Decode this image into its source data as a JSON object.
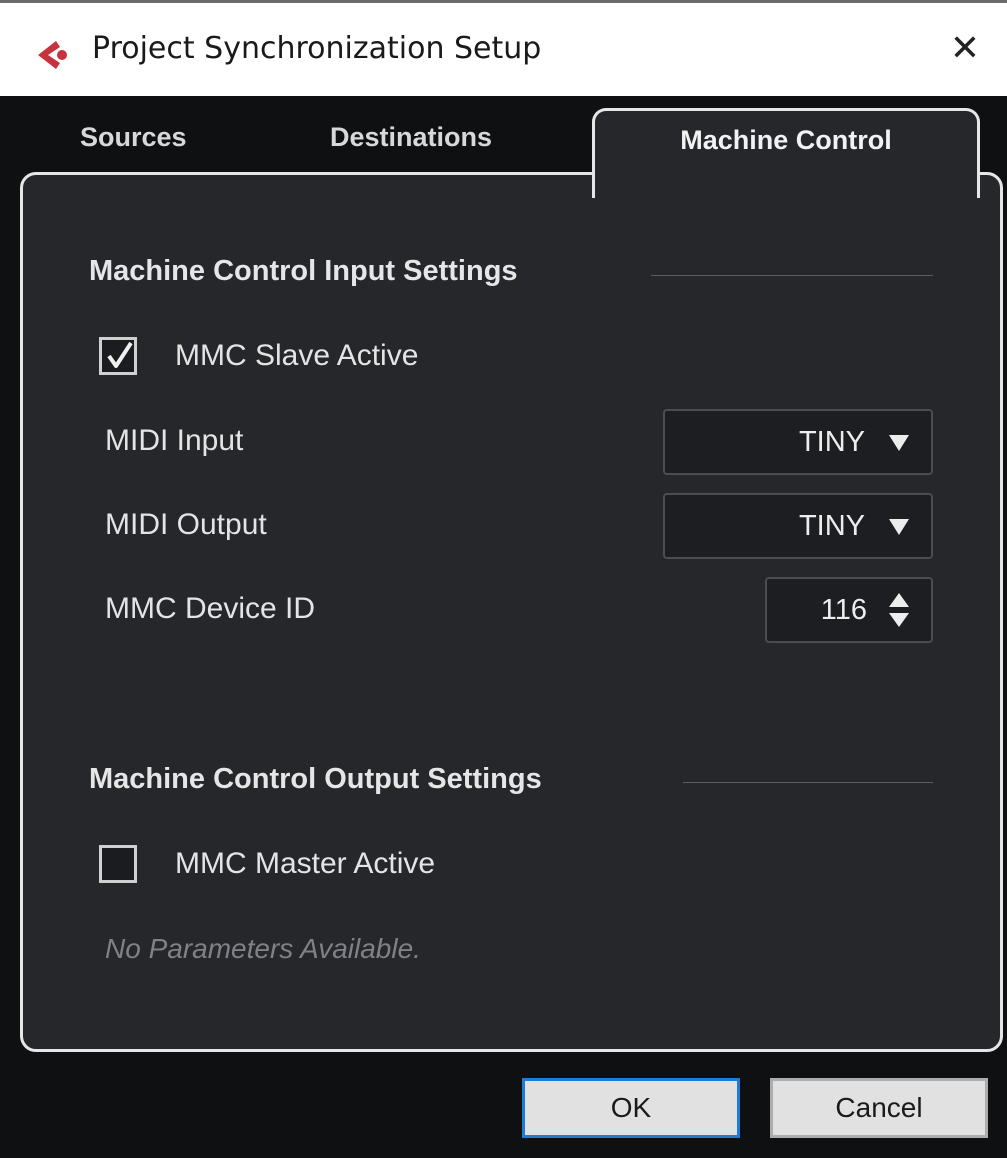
{
  "window": {
    "title": "Project Synchronization Setup",
    "icon": "cubase-logo-icon",
    "close_glyph": "✕",
    "accent_color": "#c8323c"
  },
  "tabs": [
    {
      "label": "Sources",
      "active": false
    },
    {
      "label": "Destinations",
      "active": false
    },
    {
      "label": "Machine Control",
      "active": true
    }
  ],
  "input_settings": {
    "heading": "Machine Control Input Settings",
    "slave_active": {
      "label": "MMC Slave Active",
      "checked": true
    },
    "midi_input": {
      "label": "MIDI Input",
      "value": "TINY"
    },
    "midi_output": {
      "label": "MIDI Output",
      "value": "TINY"
    },
    "device_id": {
      "label": "MMC Device ID",
      "value": "116"
    }
  },
  "output_settings": {
    "heading": "Machine Control Output Settings",
    "master_active": {
      "label": "MMC Master Active",
      "checked": false
    },
    "note": "No Parameters Available."
  },
  "buttons": {
    "ok": "OK",
    "cancel": "Cancel"
  }
}
